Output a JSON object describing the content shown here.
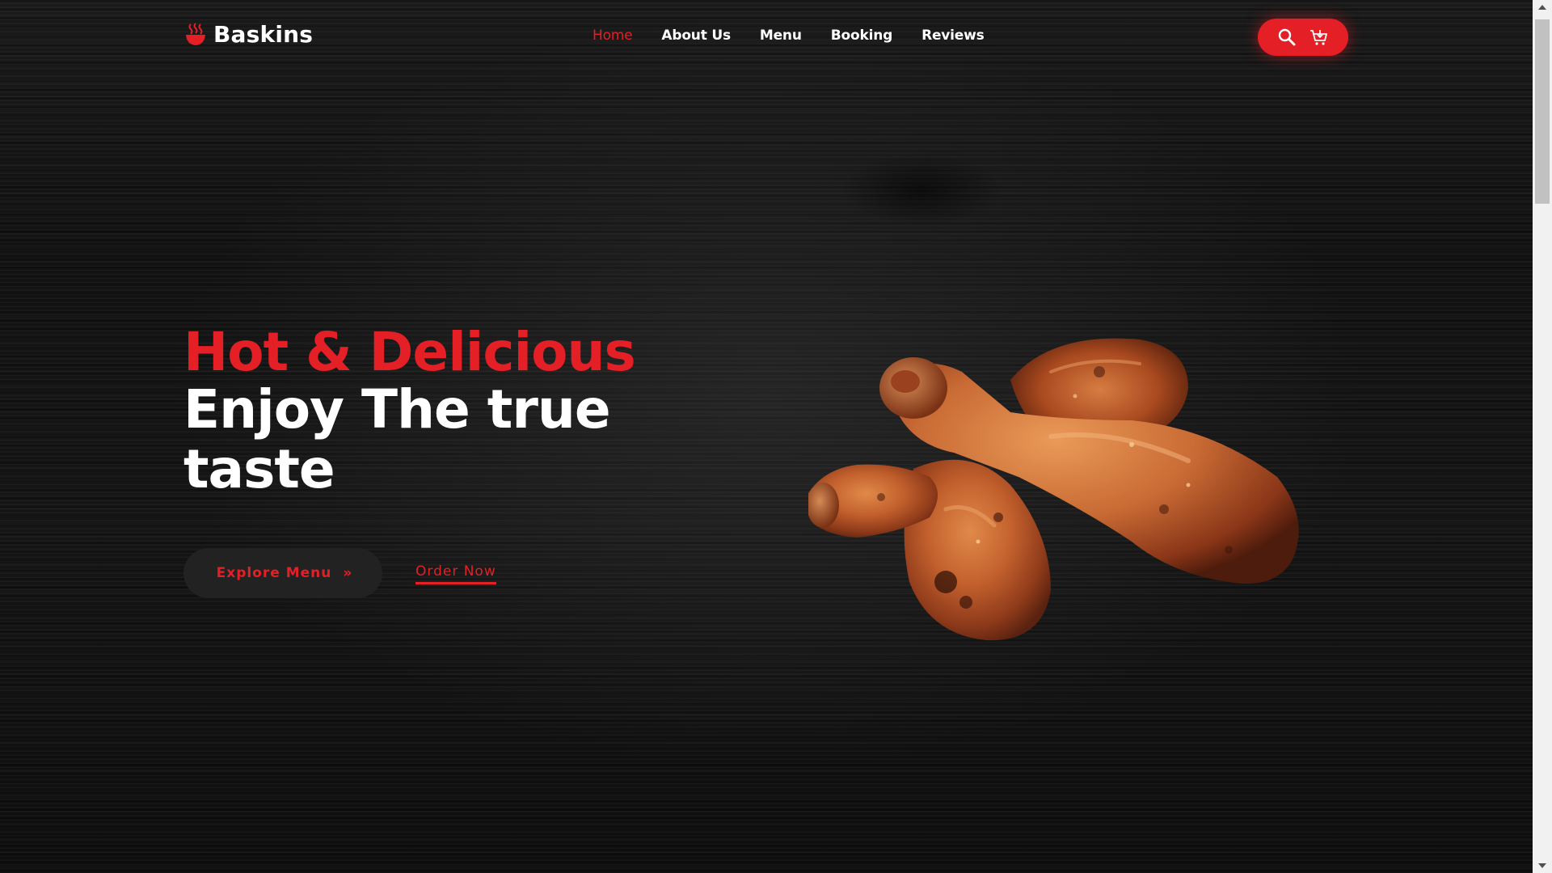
{
  "brand": {
    "name": "Baskins",
    "logo_icon": "bowl-steam-icon",
    "accent_color": "#e41f26"
  },
  "nav": {
    "items": [
      {
        "label": "Home",
        "active": true
      },
      {
        "label": "About Us",
        "active": false
      },
      {
        "label": "Menu",
        "active": false
      },
      {
        "label": "Booking",
        "active": false
      },
      {
        "label": "Reviews",
        "active": false
      }
    ]
  },
  "header_actions": {
    "search_icon": "search-icon",
    "cart_icon": "cart-icon"
  },
  "hero": {
    "title_line1": "Hot & Delicious",
    "title_line2": "Enjoy The true taste",
    "primary_button": "Explore Menu",
    "primary_button_icon": "double-chevron-right-icon",
    "secondary_link": "Order Now",
    "image": "roasted-chicken-drumsticks"
  }
}
